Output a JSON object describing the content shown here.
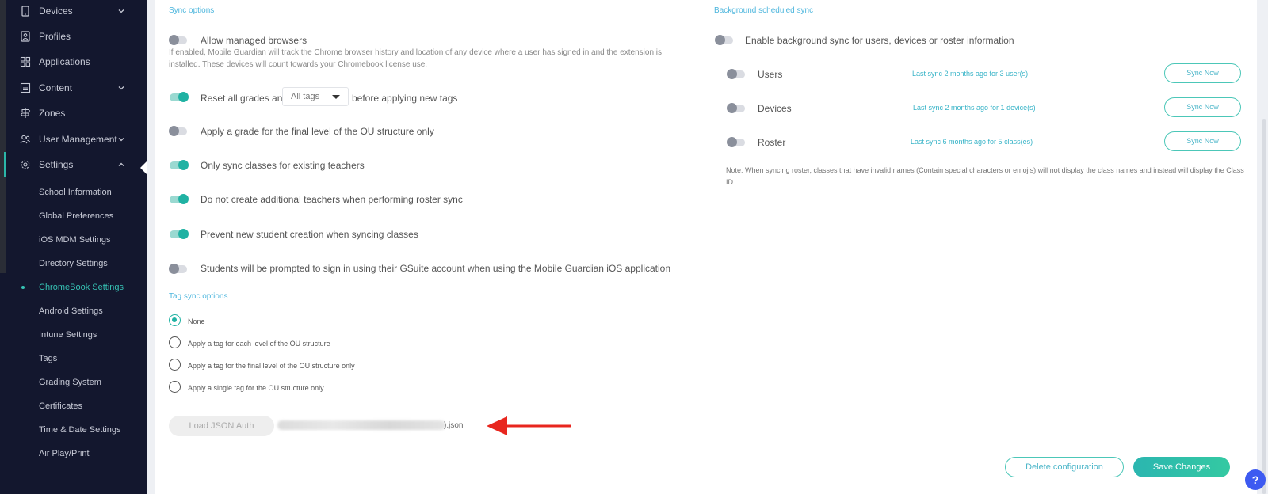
{
  "sidebar": {
    "items": [
      {
        "label": "Devices",
        "icon": "tablet-icon",
        "chevron": "down"
      },
      {
        "label": "Profiles",
        "icon": "profile-icon"
      },
      {
        "label": "Applications",
        "icon": "grid-icon"
      },
      {
        "label": "Content",
        "icon": "content-icon",
        "chevron": "down"
      },
      {
        "label": "Zones",
        "icon": "signpost-icon"
      },
      {
        "label": "User Management",
        "icon": "users-icon",
        "chevron": "down"
      },
      {
        "label": "Settings",
        "icon": "gear-icon",
        "chevron": "up"
      }
    ],
    "settings_children": [
      "School Information",
      "Global Preferences",
      "iOS MDM Settings",
      "Directory Settings",
      "ChromeBook Settings",
      "Android Settings",
      "Intune Settings",
      "Tags",
      "Grading System",
      "Certificates",
      "Time & Date Settings",
      "Air Play/Print"
    ],
    "active_child": "ChromeBook Settings"
  },
  "sync_options": {
    "title": "Sync options",
    "allow_managed": {
      "label": "Allow managed browsers",
      "description": "If enabled, Mobile Guardian will track the Chrome browser history and location of any device where a user has signed in and the extension is installed. These devices will count towards your Chromebook license use.",
      "on": false
    },
    "reset_grades": {
      "label_before": "Reset all grades and",
      "select_value": "All tags",
      "label_after": "before applying new tags",
      "on": true
    },
    "final_level_grade": {
      "label": "Apply a grade for the final level of the OU structure only",
      "on": false
    },
    "existing_teachers": {
      "label": "Only sync classes for existing teachers",
      "on": true
    },
    "no_additional_teachers": {
      "label": "Do not create additional teachers when performing roster sync",
      "on": true
    },
    "prevent_students": {
      "label": "Prevent new student creation when syncing classes",
      "on": true
    },
    "gsuite_prompt": {
      "label": "Students will be prompted to sign in using their GSuite account when using the Mobile Guardian iOS application",
      "on": false
    }
  },
  "tag_sync": {
    "title": "Tag sync options",
    "options": [
      "None",
      "Apply a tag for each level of the OU structure",
      "Apply a tag for the final level of the OU structure only",
      "Apply a single tag for the OU structure only"
    ],
    "selected": "None"
  },
  "json_auth": {
    "button": "Load JSON Auth",
    "file_suffix": ").json"
  },
  "background_sync": {
    "title": "Background scheduled sync",
    "enable_label": "Enable background sync for users, devices or roster information",
    "rows": [
      {
        "name": "Users",
        "status": "Last sync 2 months ago for 3 user(s)",
        "button": "Sync Now"
      },
      {
        "name": "Devices",
        "status": "Last sync 2 months ago for 1 device(s)",
        "button": "Sync Now"
      },
      {
        "name": "Roster",
        "status": "Last sync 6 months ago for 5 class(es)",
        "button": "Sync Now"
      }
    ],
    "note": "Note: When syncing roster, classes that have invalid names (Contain special characters or emojis) will not display the class names and instead will display the Class ID."
  },
  "actions": {
    "delete": "Delete configuration",
    "save": "Save Changes"
  },
  "help": "?",
  "colors": {
    "accent": "#20b2a3",
    "sidebar": "#13172e",
    "link": "#36b3c7",
    "annotation_arrow": "#e8261e"
  }
}
